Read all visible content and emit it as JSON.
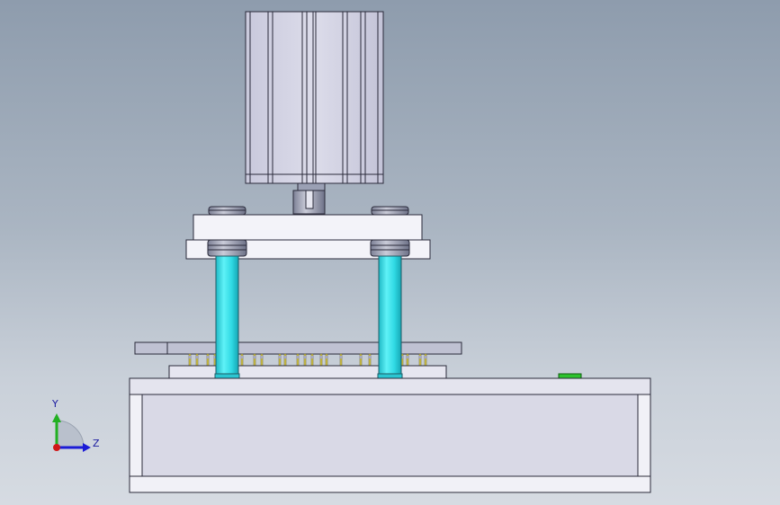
{
  "triad": {
    "y_label": "Y",
    "z_label": "Z"
  },
  "colors": {
    "background_top": "#8e9cad",
    "background_bottom": "#d6dbe2",
    "cylinder_body": "#d3d3e3",
    "guide_rod": "#35e0ea",
    "plate": "#f3f3f9",
    "base_panel": "#d9d9e6",
    "green_part": "#2ec22e",
    "axis_y": "#22b022",
    "axis_z": "#1b1bd6",
    "axis_x": "#d01818"
  }
}
